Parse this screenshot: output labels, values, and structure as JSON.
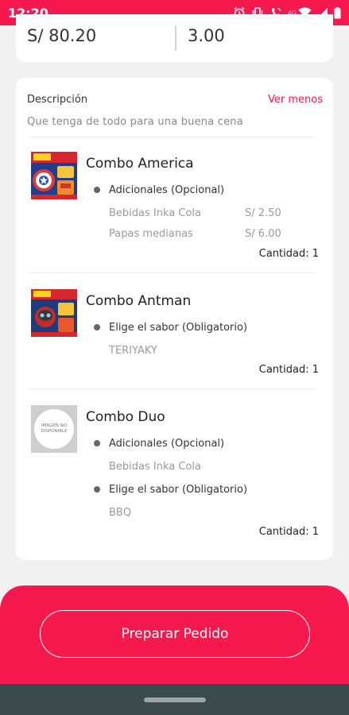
{
  "status_bar": {
    "time": "12:20",
    "network": "4G",
    "icons": [
      "alarm-icon",
      "vibrate-icon",
      "wifi-calling-icon",
      "wifi-icon",
      "signal-icon",
      "battery-icon"
    ]
  },
  "summary": {
    "left_value": "S/ 80.20",
    "right_value": "3.00"
  },
  "order": {
    "description_label": "Descripción",
    "toggle_label": "Ver menos",
    "description_text": "Que tenga de todo para una buena cena",
    "items": [
      {
        "title": "Combo America",
        "image": "combo-america-product-image",
        "groups": [
          {
            "label": "Adicionales (Opcional)",
            "options": [
              {
                "name": "Bebidas Inka Cola",
                "price": "S/ 2.50"
              },
              {
                "name": "Papas medianas",
                "price": "S/ 6.00"
              }
            ]
          }
        ],
        "quantity": "Cantidad: 1"
      },
      {
        "title": "Combo Antman",
        "image": "combo-antman-product-image",
        "groups": [
          {
            "label": "Elige el sabor (Obligatorio)",
            "options": [
              {
                "name": "TERIYAKY"
              }
            ]
          }
        ],
        "quantity": "Cantidad: 1"
      },
      {
        "title": "Combo Duo",
        "image": "no-image-placeholder",
        "image_text": "IMAGEN NO DISPONIBLE",
        "groups": [
          {
            "label": "Adicionales (Opcional)",
            "options": [
              {
                "name": "Bebidas Inka Cola"
              }
            ]
          },
          {
            "label": "Elige el sabor (Obligatorio)",
            "options": [
              {
                "name": "BBQ"
              }
            ]
          }
        ],
        "quantity": "Cantidad: 1"
      }
    ]
  },
  "actions": {
    "prepare_label": "Preparar Pedido"
  },
  "colors": {
    "accent": "#f5194d",
    "background": "#f1f1f1",
    "card": "#ffffff",
    "nav_bar": "#3b4a4c"
  }
}
